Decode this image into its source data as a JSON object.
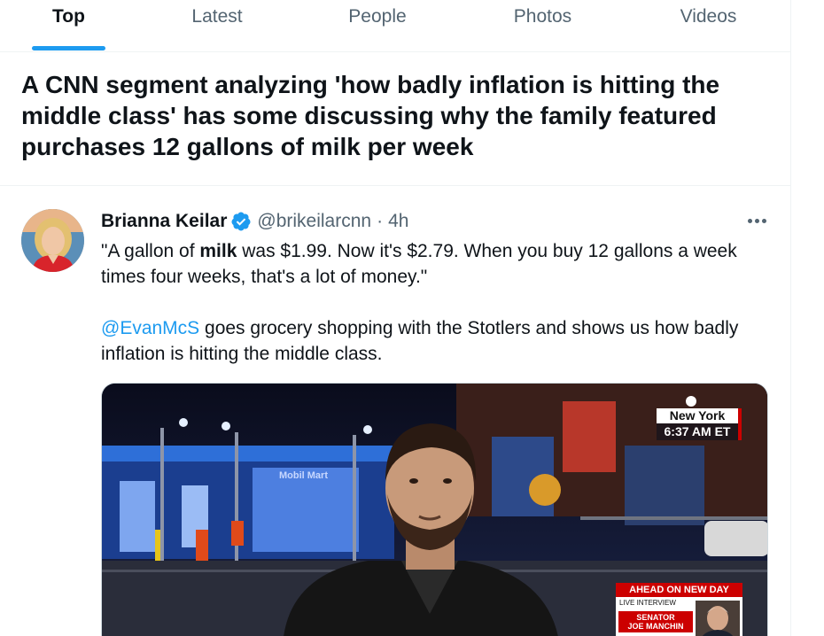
{
  "tabs": [
    {
      "label": "Top",
      "active": true
    },
    {
      "label": "Latest",
      "active": false
    },
    {
      "label": "People",
      "active": false
    },
    {
      "label": "Photos",
      "active": false
    },
    {
      "label": "Videos",
      "active": false
    }
  ],
  "headline": "A CNN segment analyzing 'how badly inflation is hitting the middle class' has some discussing why the family featured purchases 12 gallons of milk per week",
  "tweet": {
    "author_name": "Brianna Keilar",
    "handle": "@brikeilarcnn",
    "separator": "·",
    "time": "4h",
    "line1_before": "\"A gallon of ",
    "line1_bold": "milk",
    "line1_after": " was $1.99. Now it's $2.79. When you buy 12 gallons a week times four weeks, that's a lot of money.\"",
    "mention": "@EvanMcS",
    "line2_after": " goes grocery shopping with the Stotlers and shows us how badly inflation is hitting the middle class."
  },
  "media": {
    "bug_city": "New York",
    "bug_time": "6:37 AM ET",
    "station_sign": "Mobil Mart",
    "ahead_label": "AHEAD ON NEW DAY",
    "live_label": "LIVE INTERVIEW",
    "senator_line1": "SENATOR",
    "senator_line2": "JOE MANCHIN"
  },
  "colors": {
    "accent": "#1d9bf0",
    "text_primary": "#0f1419",
    "text_secondary": "#536471",
    "cnn_red": "#cc0000"
  },
  "icons": {
    "verified": "verified-badge-icon",
    "more": "more-horizontal-icon"
  }
}
